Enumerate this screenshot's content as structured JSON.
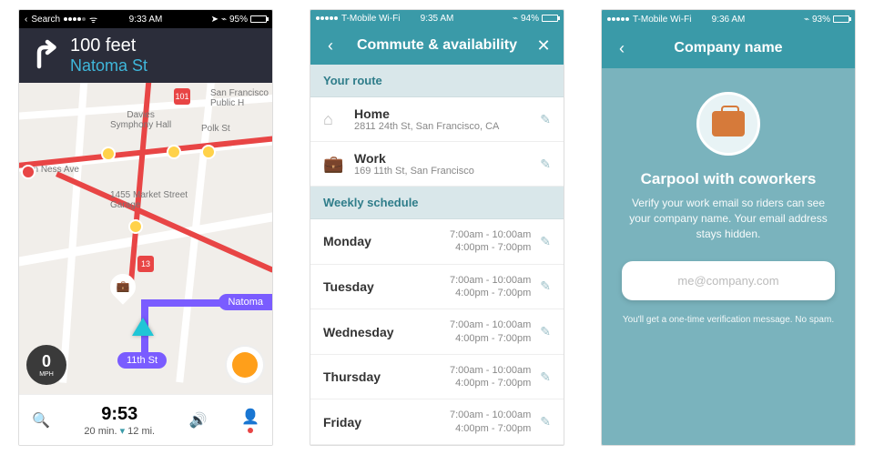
{
  "phone1": {
    "status": {
      "carrier": "Search",
      "time": "9:33 AM",
      "battery": "95%"
    },
    "nav": {
      "distance": "100 feet",
      "street": "Natoma St"
    },
    "map": {
      "streets": {
        "van_ness": "Van Ness Ave",
        "davies": "Davies\nSymphony Hall",
        "polk": "Polk St",
        "market_garage": "1455 Market Street\nGarage",
        "sf_public": "San Francisco\nPublic H"
      },
      "shield_101_a": "101",
      "shield_13": "13",
      "label_natoma": "Natoma",
      "label_11th": "11th St"
    },
    "speed": {
      "value": "0",
      "unit": "MPH"
    },
    "footer": {
      "eta": "9:53",
      "duration": "20 min.",
      "distance": "12 mi."
    }
  },
  "phone2": {
    "status": {
      "carrier": "T-Mobile Wi-Fi",
      "time": "9:35 AM",
      "battery": "94%"
    },
    "header": "Commute & availability",
    "section_route": "Your route",
    "home": {
      "label": "Home",
      "addr": "2811 24th St, San Francisco, CA"
    },
    "work": {
      "label": "Work",
      "addr": "169 11th St, San Francisco"
    },
    "section_sched": "Weekly schedule",
    "days": [
      {
        "name": "Monday",
        "l1": "7:00am - 10:00am",
        "l2": "4:00pm - 7:00pm"
      },
      {
        "name": "Tuesday",
        "l1": "7:00am - 10:00am",
        "l2": "4:00pm - 7:00pm"
      },
      {
        "name": "Wednesday",
        "l1": "7:00am - 10:00am",
        "l2": "4:00pm - 7:00pm"
      },
      {
        "name": "Thursday",
        "l1": "7:00am - 10:00am",
        "l2": "4:00pm - 7:00pm"
      },
      {
        "name": "Friday",
        "l1": "7:00am - 10:00am",
        "l2": "4:00pm - 7:00pm"
      }
    ]
  },
  "phone3": {
    "status": {
      "carrier": "T-Mobile Wi-Fi",
      "time": "9:36 AM",
      "battery": "93%"
    },
    "header": "Company name",
    "title": "Carpool with coworkers",
    "desc": "Verify your work email so riders can see your company name. Your email address stays hidden.",
    "placeholder": "me@company.com",
    "fine": "You'll get a one-time verification message. No spam."
  }
}
